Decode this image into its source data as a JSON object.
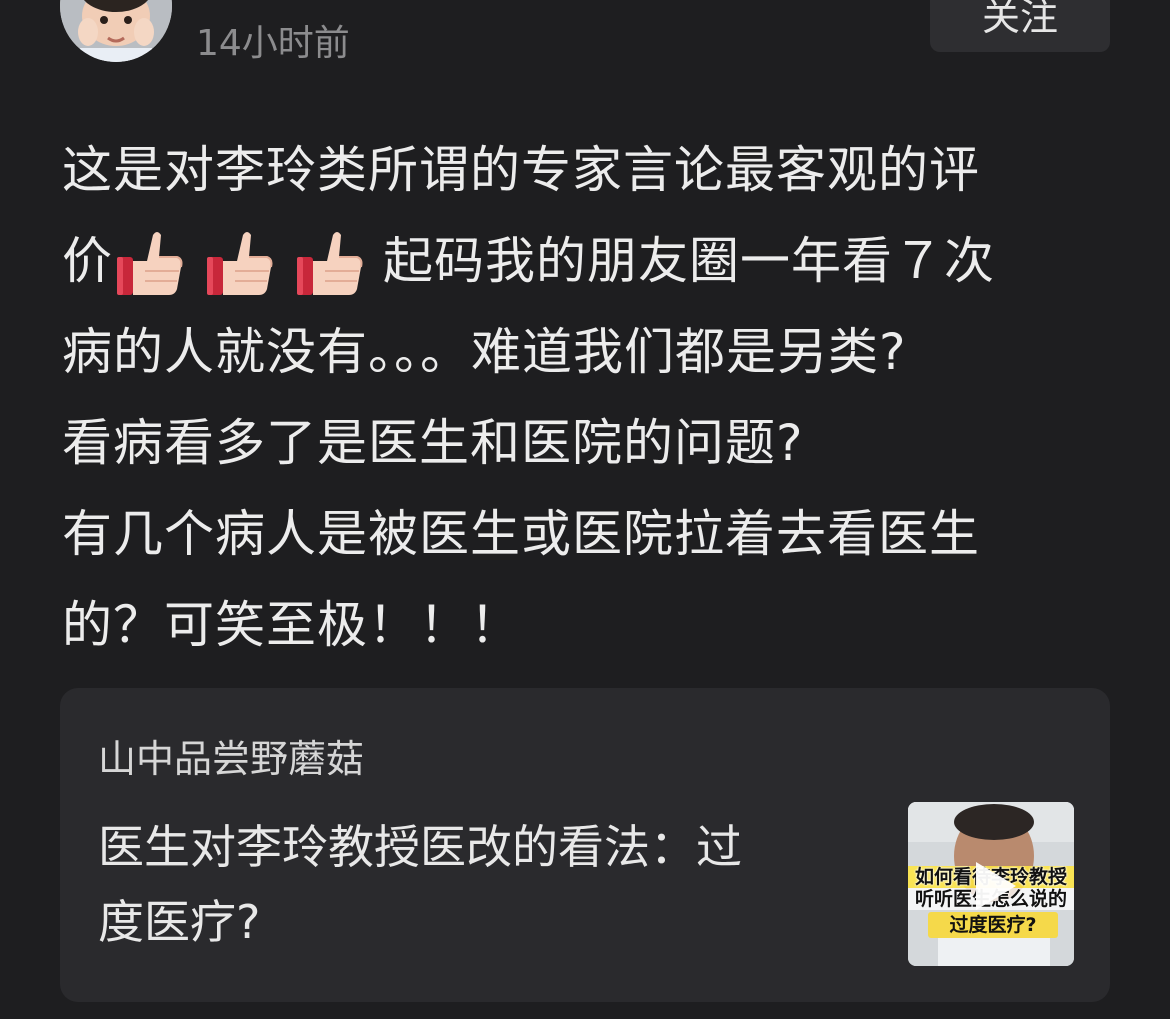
{
  "header": {
    "username": "",
    "timestamp": "14小时前",
    "follow_label": "关注"
  },
  "post": {
    "lines": [
      "这是对李玲类所谓的专家言论最客观的评",
      "价",
      "起码我的朋友圈一年看７次",
      "病的人就没有。。。难道我们都是另类?",
      "看病看多了是医生和医院的问题?",
      "有几个病人是被医生或医院拉着去看医生",
      "的？可笑至极！！！"
    ],
    "emoji": [
      "thumbs-up",
      "thumbs-up",
      "thumbs-up"
    ]
  },
  "shared_video": {
    "author": "山中品尝野蘑菇",
    "title_lines": [
      "医生对李玲教授医改的看法：过",
      "度医疗?"
    ],
    "thumbnail_caption": {
      "line1": "如何看待李玲教授",
      "line2": "听听医生怎么说的",
      "line3": "过度医疗?"
    }
  }
}
